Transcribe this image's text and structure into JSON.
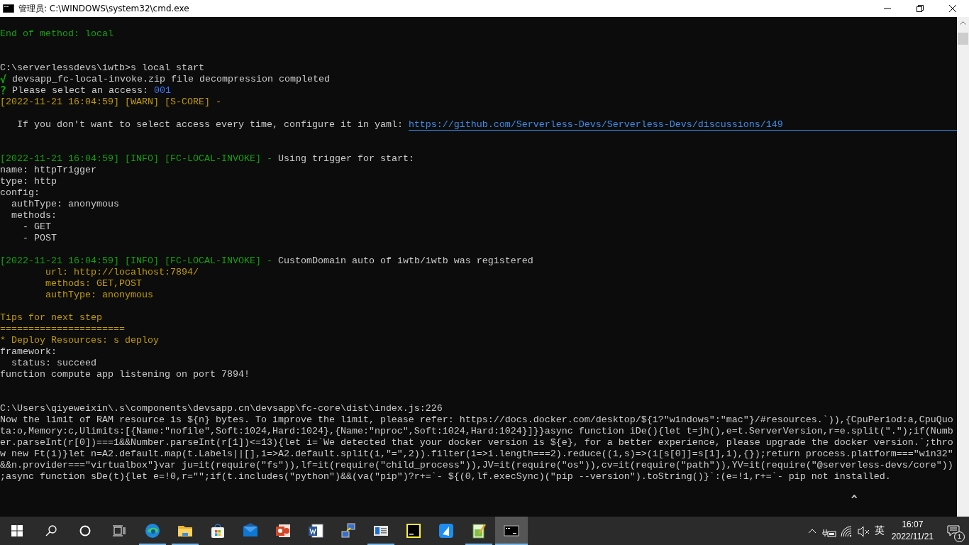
{
  "window": {
    "title": "管理员:  C:\\WINDOWS\\system32\\cmd.exe"
  },
  "console": {
    "lines": [
      {
        "kind": "spaced",
        "segments": [
          {
            "text": "End of method: local",
            "color": "#13a10e"
          }
        ]
      },
      {
        "kind": "widespaced",
        "segments": [
          {
            "text": "C:\\serverlessdevs\\iwtb>s local start",
            "color": "#cccccc"
          }
        ]
      },
      {
        "segments": [
          {
            "text": "√",
            "color": "#13a10e"
          },
          {
            "text": " devsapp_fc-local-invoke.zip file decompression completed",
            "color": "#cccccc"
          }
        ]
      },
      {
        "segments": [
          {
            "text": "?",
            "color": "#13a10e"
          },
          {
            "text": " Please select an access: ",
            "color": "#cccccc"
          },
          {
            "text": "001",
            "color": "#3b78ff"
          }
        ]
      },
      {
        "segments": [
          {
            "text": "[2022-11-21 16:04:59] [WARN] [S-CORE] -",
            "color": "#c19c00"
          }
        ]
      },
      {
        "kind": "spaced",
        "segments": [
          {
            "text": "   If you don't want to select access every time, configure it in yaml: ",
            "color": "#cccccc"
          },
          {
            "text": "https://github.com/Serverless-Devs/Serverless-Devs/discussions/149",
            "color": "#3b8eea",
            "kind": "link"
          }
        ]
      },
      {
        "kind": "widespaced",
        "segments": [
          {
            "text": "[2022-11-21 16:04:59] [INFO] [FC-LOCAL-INVOKE] - ",
            "color": "#13a10e"
          },
          {
            "text": "Using trigger for start:",
            "color": "#cccccc"
          }
        ]
      },
      {
        "segments": [
          {
            "text": "name: httpTrigger",
            "color": "#cccccc"
          }
        ]
      },
      {
        "segments": [
          {
            "text": "type: http",
            "color": "#cccccc"
          }
        ]
      },
      {
        "segments": [
          {
            "text": "config:",
            "color": "#cccccc"
          }
        ]
      },
      {
        "segments": [
          {
            "text": "  authType: anonymous",
            "color": "#cccccc"
          }
        ]
      },
      {
        "segments": [
          {
            "text": "  methods:",
            "color": "#cccccc"
          }
        ]
      },
      {
        "segments": [
          {
            "text": "    - GET",
            "color": "#cccccc"
          }
        ]
      },
      {
        "segments": [
          {
            "text": "    - POST",
            "color": "#cccccc"
          }
        ]
      },
      {
        "kind": "spaced",
        "segments": [
          {
            "text": "[2022-11-21 16:04:59] [INFO] [FC-LOCAL-INVOKE] - ",
            "color": "#13a10e"
          },
          {
            "text": "CustomDomain auto of iwtb/iwtb was registered",
            "color": "#cccccc"
          }
        ]
      },
      {
        "segments": [
          {
            "text": "        url: http://localhost:7894/",
            "color": "#c19c00"
          }
        ]
      },
      {
        "segments": [
          {
            "text": "        methods: GET,POST",
            "color": "#c19c00"
          }
        ]
      },
      {
        "segments": [
          {
            "text": "        authType: anonymous",
            "color": "#c19c00"
          }
        ]
      },
      {
        "kind": "spaced",
        "segments": [
          {
            "text": "Tips for next step",
            "color": "#c19c00"
          }
        ]
      },
      {
        "segments": [
          {
            "text": "======================",
            "color": "#c19c00"
          }
        ]
      },
      {
        "segments": [
          {
            "text": "* Deploy Resources: s deploy",
            "color": "#c19c00"
          }
        ]
      },
      {
        "segments": [
          {
            "text": "framework:",
            "color": "#cccccc"
          }
        ]
      },
      {
        "segments": [
          {
            "text": "  status: succeed",
            "color": "#cccccc"
          }
        ]
      },
      {
        "segments": [
          {
            "text": "function compute app listening on port 7894!",
            "color": "#cccccc"
          }
        ]
      },
      {
        "kind": "widespaced",
        "segments": [
          {
            "text": "C:\\Users\\qiyeweixin\\.s\\components\\devsapp.cn\\devsapp\\fc-core\\dist\\index.js:226",
            "color": "#cccccc"
          }
        ]
      },
      {
        "segments": [
          {
            "text": "Now the limit of RAM resource is ${n} bytes. To improve the limit, please refer: https://docs.docker.com/desktop/${i?\"windows\":\"mac\"}/#resources.`)),{CpuPeriod:a,CpuQuo",
            "color": "#cccccc"
          }
        ]
      },
      {
        "segments": [
          {
            "text": "ta:o,Memory:c,Ulimits:[{Name:\"nofile\",Soft:1024,Hard:1024},{Name:\"nproc\",Soft:1024,Hard:1024}]}}async function iDe(){let t=jh(),e=t.ServerVersion,r=e.split(\".\");if(Numb",
            "color": "#cccccc"
          }
        ]
      },
      {
        "segments": [
          {
            "text": "er.parseInt(r[0])===1&&Number.parseInt(r[1])<=13){let i=`We detected that your docker version is ${e}, for a better experience, please upgrade the docker version.`;thro",
            "color": "#cccccc"
          }
        ]
      },
      {
        "segments": [
          {
            "text": "w new Ft(i)}let n=A2.default.map(t.Labels||[],i=>A2.default.split(i,\"=\",2)).filter(i=>i.length===2).reduce((i,s)=>(i[s[0]]=s[1],i),{});return process.platform===\"win32\"",
            "color": "#cccccc"
          }
        ]
      },
      {
        "segments": [
          {
            "text": "&&n.provider===\"virtualbox\"}var ju=it(require(\"fs\")),lf=it(require(\"child_process\")),JV=it(require(\"os\")),cv=it(require(\"path\")),YV=it(require(\"@serverless-devs/core\"))",
            "color": "#cccccc"
          }
        ]
      },
      {
        "segments": [
          {
            "text": ";async function sDe(t){let e=!0,r=\"\";if(t.includes(\"python\")&&(va(\"pip\")?r+=`- ${(0,lf.execSync)(\"pip --version\").toString()}`:(e=!1,r+=`- pip not installed.",
            "color": "#cccccc"
          }
        ]
      },
      {
        "kind": "spaced",
        "segments": [
          {
            "text": "                                                                                                                                                      ^",
            "color": "#cccccc"
          }
        ]
      }
    ]
  },
  "taskbar": {
    "items": [
      {
        "kind": "edge",
        "running": true,
        "active": false
      },
      {
        "kind": "folder",
        "running": true,
        "active": false
      },
      {
        "kind": "store",
        "running": false,
        "active": false
      },
      {
        "kind": "mail",
        "running": false,
        "active": false
      },
      {
        "kind": "slides",
        "running": false,
        "active": false
      },
      {
        "kind": "word",
        "running": false,
        "active": false
      },
      {
        "kind": "network",
        "running": false,
        "active": false
      },
      {
        "kind": "panel",
        "running": true,
        "active": false
      },
      {
        "kind": "ide",
        "running": false,
        "active": false
      },
      {
        "kind": "bird",
        "running": false,
        "active": false
      },
      {
        "kind": "notepad",
        "running": true,
        "active": false
      },
      {
        "kind": "terminal",
        "running": true,
        "active": true
      }
    ],
    "ime": "英",
    "time": "16:07",
    "date": "2022/11/21",
    "notifications": "1"
  }
}
